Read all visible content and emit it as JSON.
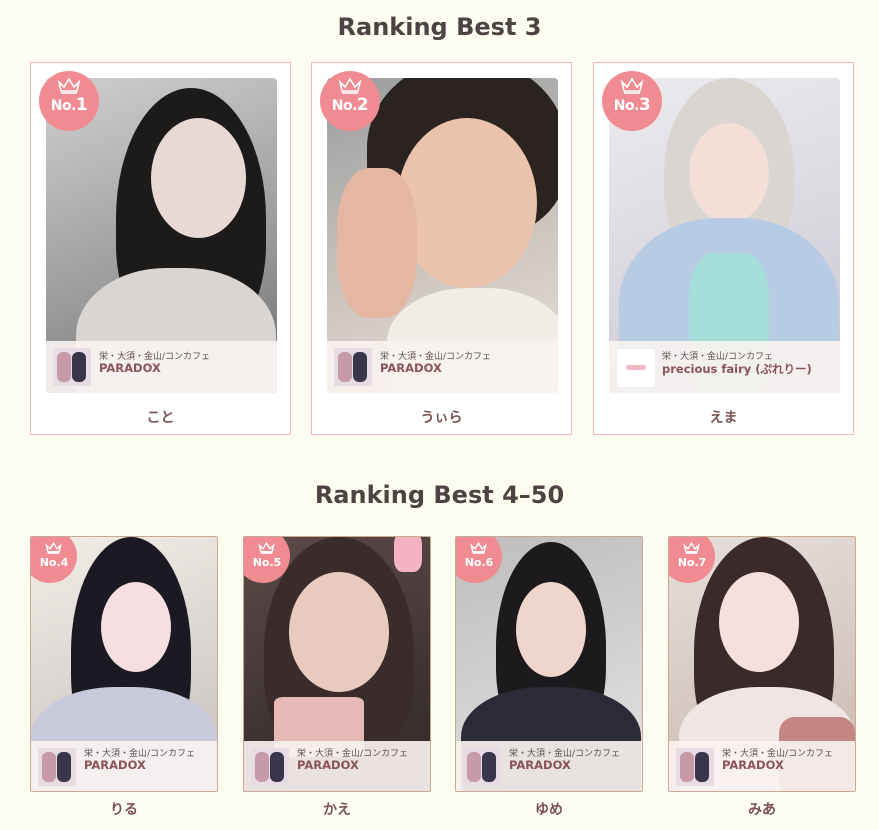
{
  "top_section": {
    "title": "Ranking Best 3"
  },
  "bottom_section": {
    "title": "Ranking Best 4–50"
  },
  "top_cards": [
    {
      "rank_label": "No.",
      "rank": "1",
      "area": "栄・大須・金山/コンカフェ",
      "shop": "PARADOX",
      "name": "こと"
    },
    {
      "rank_label": "No.",
      "rank": "2",
      "area": "栄・大須・金山/コンカフェ",
      "shop": "PARADOX",
      "name": "うぃら"
    },
    {
      "rank_label": "No.",
      "rank": "3",
      "area": "栄・大須・金山/コンカフェ",
      "shop": "precious fairy (ぷれりー)",
      "name": "えま"
    }
  ],
  "bottom_cards": [
    {
      "rank_label": "No.",
      "rank": "4",
      "area": "栄・大須・金山/コンカフェ",
      "shop": "PARADOX",
      "name": "りる"
    },
    {
      "rank_label": "No.",
      "rank": "5",
      "area": "栄・大須・金山/コンカフェ",
      "shop": "PARADOX",
      "name": "かえ"
    },
    {
      "rank_label": "No.",
      "rank": "6",
      "area": "栄・大須・金山/コンカフェ",
      "shop": "PARADOX",
      "name": "ゆめ"
    },
    {
      "rank_label": "No.",
      "rank": "7",
      "area": "栄・大須・金山/コンカフェ",
      "shop": "PARADOX",
      "name": "みあ"
    }
  ],
  "colors": {
    "badge": "#f08c91",
    "card_border_top": "#f2b7bd",
    "card_border_bottom": "#c9a894",
    "background": "#fdfcf0"
  },
  "icons": {
    "badge": "crown-icon"
  }
}
